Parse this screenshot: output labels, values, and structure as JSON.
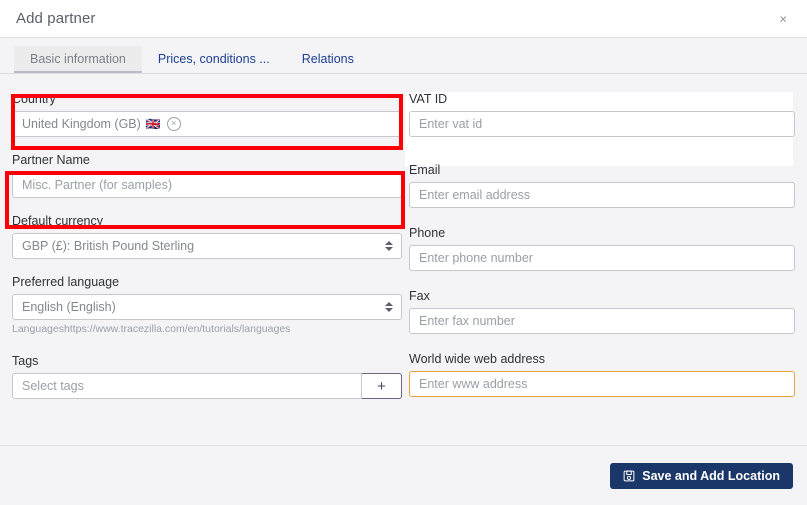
{
  "modal": {
    "title": "Add partner",
    "close_label": "×"
  },
  "tabs": [
    {
      "label": "Basic information",
      "active": true
    },
    {
      "label": "Prices, conditions ...",
      "active": false
    },
    {
      "label": "Relations",
      "active": false
    }
  ],
  "form": {
    "country": {
      "label": "Country",
      "value": "United Kingdom (GB)",
      "flag": "🇬🇧",
      "clear_label": "×"
    },
    "vat_id": {
      "label": "VAT ID",
      "placeholder": "Enter vat id",
      "value": ""
    },
    "partner_name": {
      "label": "Partner Name",
      "placeholder": "Misc. Partner (for samples)",
      "value": ""
    },
    "email": {
      "label": "Email",
      "placeholder": "Enter email address",
      "value": ""
    },
    "default_currency": {
      "label": "Default currency",
      "value": "GBP (£): British Pound Sterling"
    },
    "phone": {
      "label": "Phone",
      "placeholder": "Enter phone number",
      "value": ""
    },
    "preferred_language": {
      "label": "Preferred language",
      "value": "English (English)",
      "help": "Languageshttps://www.tracezilla.com/en/tutorials/languages"
    },
    "fax": {
      "label": "Fax",
      "placeholder": "Enter fax number",
      "value": ""
    },
    "tags": {
      "label": "Tags",
      "placeholder": "Select tags",
      "value": "",
      "add_label": "+"
    },
    "website": {
      "label": "World wide web address",
      "placeholder": "Enter www address",
      "value": ""
    }
  },
  "footer": {
    "save_label": "Save and Add Location"
  },
  "colors": {
    "annotation": "#fb0007",
    "primary_button": "#1b3668",
    "highlight_border": "#e8a33d",
    "tab_link": "#1c3f94"
  }
}
